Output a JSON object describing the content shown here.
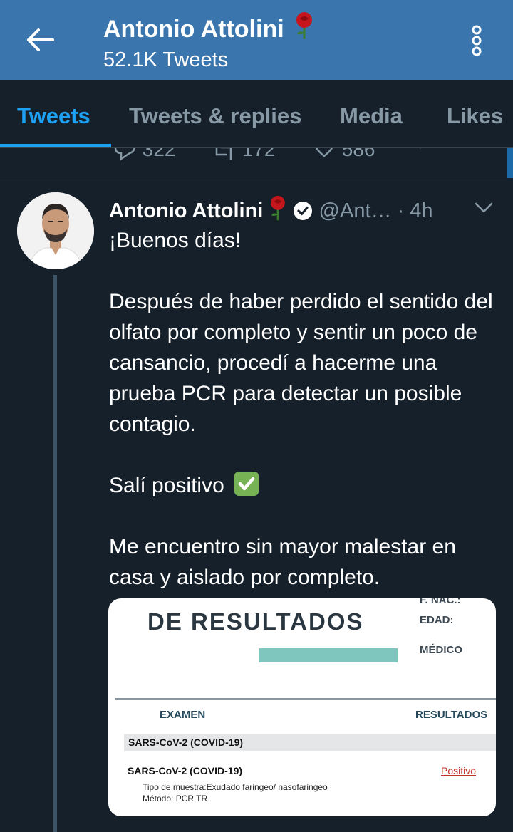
{
  "header": {
    "title": "Antonio Attolini",
    "title_emoji": "rose-icon",
    "tweet_count": "52.1K Tweets",
    "background": "#3a76ad"
  },
  "tabs": [
    {
      "label": "Tweets",
      "active": true
    },
    {
      "label": "Tweets & replies",
      "active": false
    },
    {
      "label": "Media",
      "active": false
    },
    {
      "label": "Likes",
      "active": false
    }
  ],
  "previous_tweet": {
    "replies": "322",
    "retweets": "172",
    "likes": "586"
  },
  "tweet": {
    "author_name": "Antonio Attolini",
    "handle": "@Ant…",
    "time": "· 4h",
    "verified": true,
    "paragraphs": [
      "¡Buenos días!",
      "Después de haber perdido el sentido del olfato por completo y sentir un poco de cansancio, procedí a hacerme una prueba PCR para detectar un posible contagio.",
      "Salí positivo",
      "Me encuentro sin mayor malestar en casa y aislado por completo."
    ]
  },
  "media": {
    "title": "DE RESULTADOS",
    "field_fnac": "F. NAC.:",
    "field_edad": "EDAD:",
    "field_medico": "MÉDICO",
    "col_examen": "EXAMEN",
    "col_resultados": "RESULTADOS",
    "section": "SARS-CoV-2 (COVID-19)",
    "row_test": "SARS-CoV-2 (COVID-19)",
    "row_result": "Positivo",
    "sample_type": "Tipo de muestra:Exudado faringeo/ nasofaringeo",
    "method": "Método: PCR TR"
  },
  "colors": {
    "background": "#15202b",
    "accent": "#1da1f2",
    "muted": "#8899a6",
    "positive_red": "#c0322b"
  }
}
